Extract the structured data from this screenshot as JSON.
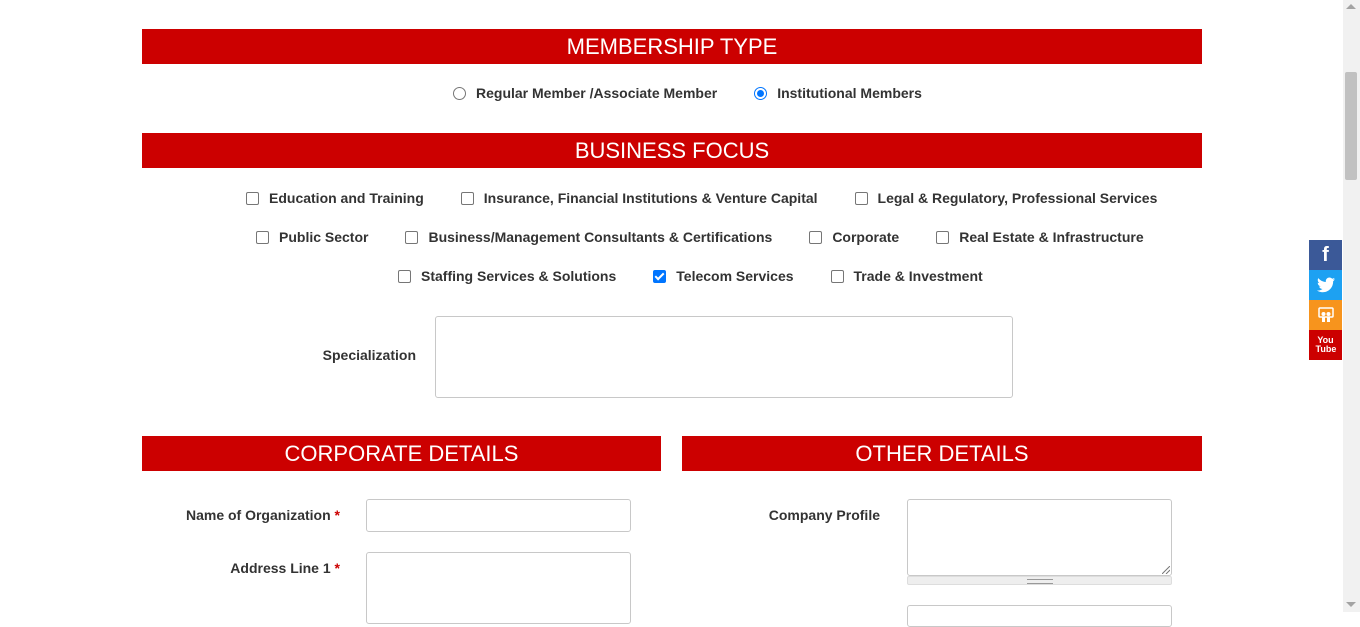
{
  "sections": {
    "membership_type": "MEMBERSHIP TYPE",
    "business_focus": "BUSINESS FOCUS",
    "corporate_details": "CORPORATE DETAILS",
    "other_details": "OTHER DETAILS"
  },
  "membership": {
    "options": [
      "Regular Member /Associate Member",
      "Institutional Members"
    ],
    "selected": "Institutional Members"
  },
  "business_focus": {
    "row1": [
      "Education and Training",
      "Insurance, Financial Institutions & Venture Capital",
      "Legal & Regulatory, Professional Services"
    ],
    "row2": [
      "Public Sector",
      "Business/Management Consultants & Certifications",
      "Corporate",
      "Real Estate & Infrastructure"
    ],
    "row3": [
      "Staffing Services & Solutions",
      "Telecom Services",
      "Trade & Investment"
    ],
    "checked": [
      "Telecom Services"
    ]
  },
  "specialization": {
    "label": "Specialization",
    "value": ""
  },
  "corporate": {
    "org_label": "Name of Organization",
    "addr1_label": "Address Line 1",
    "required_mark": "*"
  },
  "other": {
    "company_profile_label": "Company Profile"
  },
  "social": {
    "facebook_color": "#3b5998",
    "twitter_color": "#1da1f2",
    "slideshare_color": "#f7941d",
    "youtube_color": "#cc0000",
    "youtube_text": "You Tube"
  }
}
